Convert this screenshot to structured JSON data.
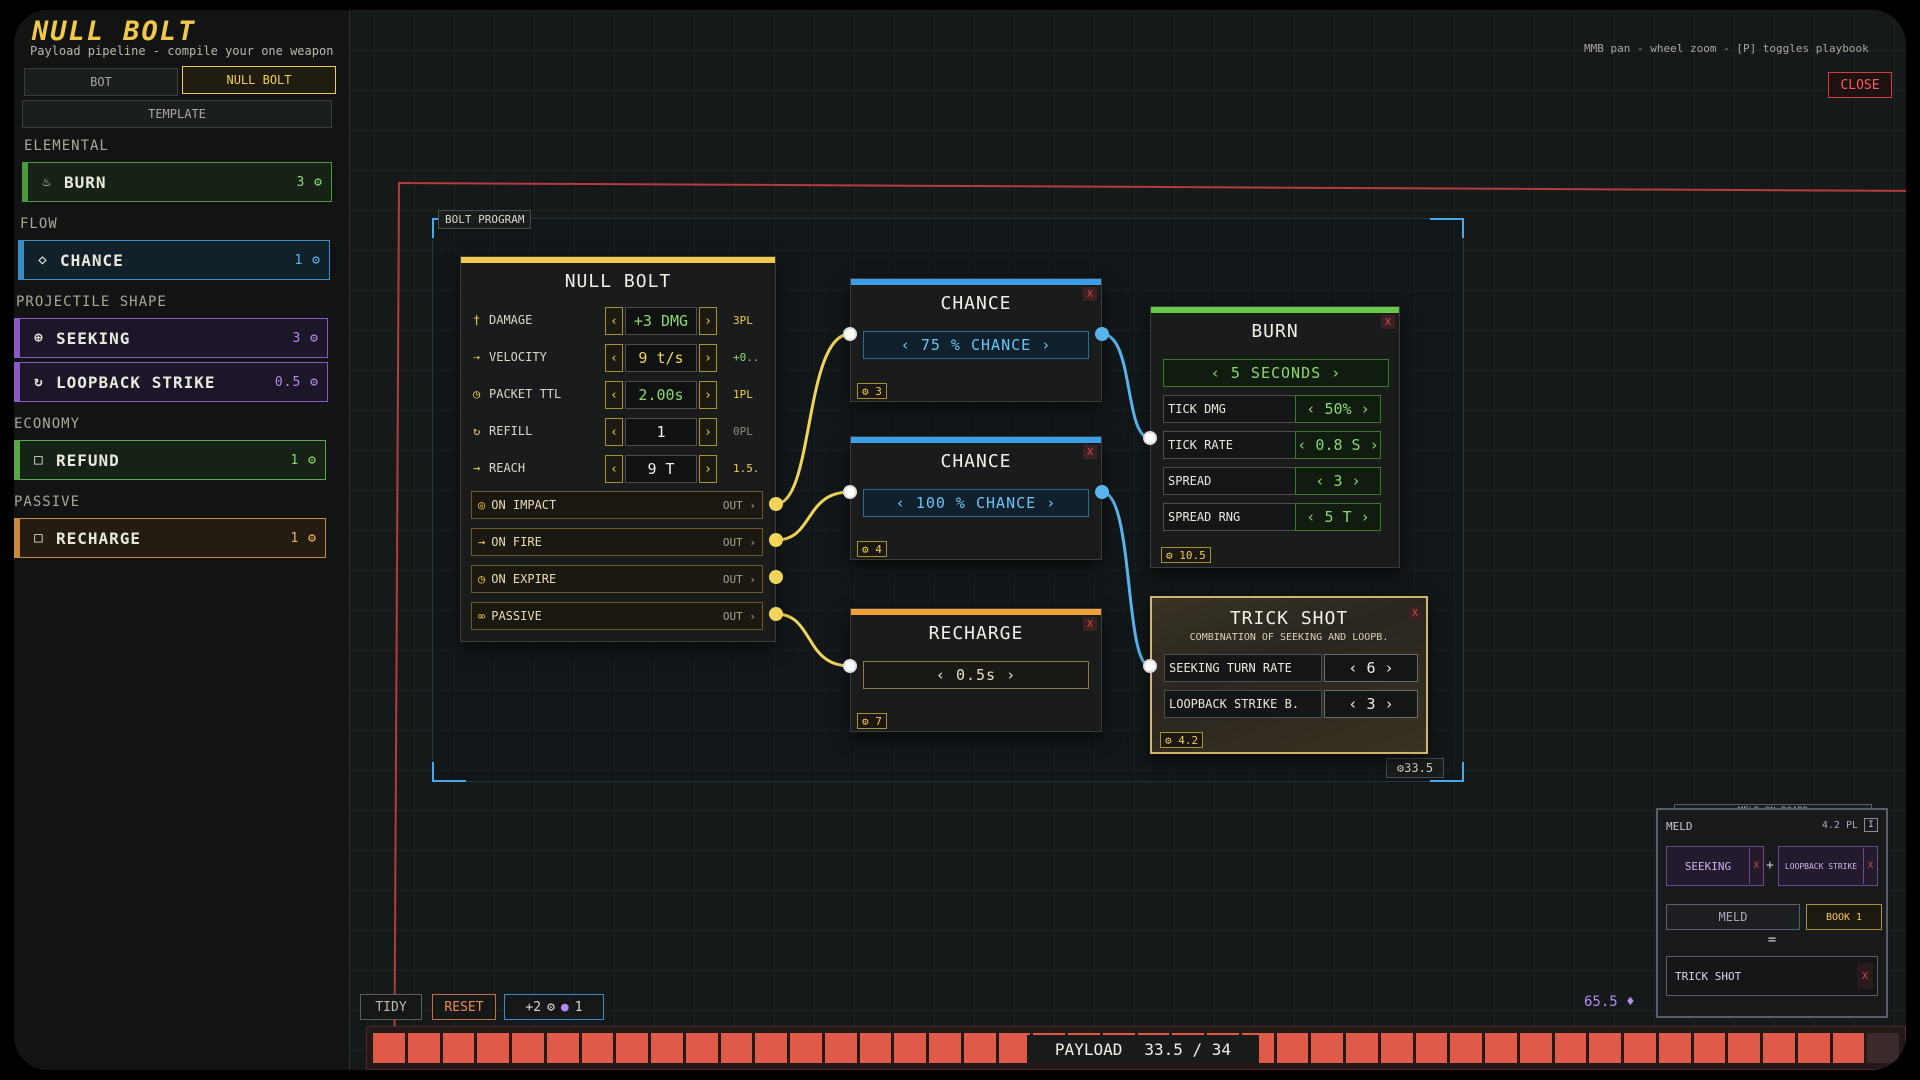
{
  "header": {
    "title": "NULL BOLT",
    "subtitle": "Payload pipeline - compile your one weapon",
    "hint": "MMB pan - wheel zoom - [P] toggles playbook",
    "close_label": "CLOSE"
  },
  "sidebar": {
    "tabs": {
      "bot": "BOT",
      "null_bolt": "NULL BOLT",
      "template": "TEMPLATE"
    },
    "categories": [
      "ELEMENTAL",
      "FLOW",
      "PROJECTILE SHAPE",
      "ECONOMY",
      "PASSIVE"
    ],
    "cards": [
      {
        "label": "BURN",
        "cost": "3",
        "icon": "flame-icon"
      },
      {
        "label": "CHANCE",
        "cost": "1",
        "icon": "diamond-icon"
      },
      {
        "label": "SEEKING",
        "cost": "3",
        "icon": "crosshair-icon"
      },
      {
        "label": "LOOPBACK STRIKE",
        "cost": "0.5",
        "icon": "loop-icon"
      },
      {
        "label": "REFUND",
        "cost": "1",
        "icon": "square-icon"
      },
      {
        "label": "RECHARGE",
        "cost": "1",
        "icon": "square-icon"
      }
    ]
  },
  "board": {
    "program_label": "BOLT PROGRAM",
    "total_cost": "33.5",
    "null_bolt": {
      "title": "NULL BOLT",
      "stats": [
        {
          "label": "DAMAGE",
          "value": "+3 DMG",
          "extra": "3PL"
        },
        {
          "label": "VELOCITY",
          "value": "9 t/s",
          "extra": "+0.."
        },
        {
          "label": "PACKET TTL",
          "value": "2.00s",
          "extra": "1PL"
        },
        {
          "label": "REFILL",
          "value": "1",
          "extra": "0PL"
        },
        {
          "label": "REACH",
          "value": "9 T",
          "extra": "1.5."
        }
      ],
      "triggers": [
        {
          "label": "ON IMPACT",
          "out": "OUT"
        },
        {
          "label": "ON FIRE",
          "out": "OUT"
        },
        {
          "label": "ON EXPIRE",
          "out": "OUT"
        },
        {
          "label": "PASSIVE",
          "out": "OUT"
        }
      ]
    },
    "chance1": {
      "title": "CHANCE",
      "value": "75 % CHANCE",
      "cost": "3"
    },
    "chance2": {
      "title": "CHANCE",
      "value": "100 % CHANCE",
      "cost": "4"
    },
    "recharge": {
      "title": "RECHARGE",
      "value": "0.5s",
      "cost": "7"
    },
    "burn": {
      "title": "BURN",
      "duration": "5 SECONDS",
      "rows": [
        {
          "k": "TICK DMG",
          "v": "50%"
        },
        {
          "k": "TICK RATE",
          "v": "0.8 S"
        },
        {
          "k": "SPREAD",
          "v": "3"
        },
        {
          "k": "SPREAD RNG",
          "v": "5 T"
        }
      ],
      "cost": "10.5"
    },
    "trick_shot": {
      "title": "TRICK SHOT",
      "subtitle": "COMBINATION OF SEEKING AND LOOPB.",
      "rows": [
        {
          "k": "SEEKING TURN RATE",
          "v": "6"
        },
        {
          "k": "LOOPBACK STRIKE B.",
          "v": "3"
        }
      ],
      "cost": "4.2"
    },
    "node_close": "X"
  },
  "toolbar": {
    "tidy": "TIDY",
    "reset": "RESET",
    "chip_cost": "+2",
    "chip_gem": "1"
  },
  "payload": {
    "label": "PAYLOAD",
    "value": "33.5 / 34",
    "fill": 0.985,
    "segments": 44
  },
  "meld": {
    "tab": "MELD ON BOARD",
    "title": "MELD",
    "cost": "4.2 PL",
    "info": "I",
    "slot_a": "SEEKING",
    "slot_b": "LOOPBACK STRIKE",
    "plus": "+",
    "meld_btn": "MELD",
    "book_btn": "BOOK 1",
    "equals": "=",
    "result": "TRICK SHOT",
    "x": "X"
  },
  "currency": {
    "value": "65.5"
  },
  "colors": {
    "accent": "#f2c94c",
    "flow_blue": "#5ab4ec",
    "elemental_green": "#8ad86a",
    "danger": "#e05a4a",
    "shape_purple": "#b48aec"
  }
}
